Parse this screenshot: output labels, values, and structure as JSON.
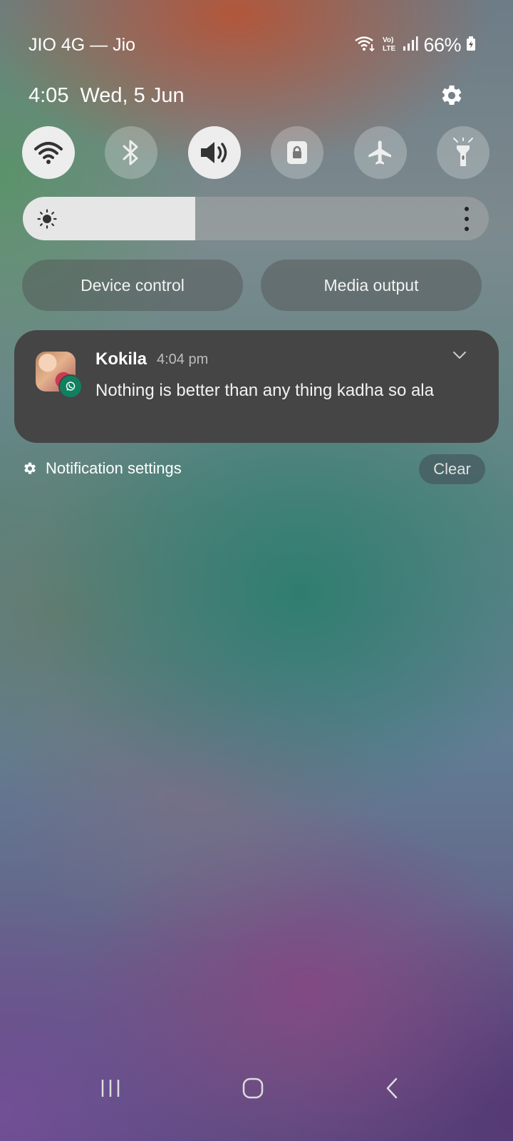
{
  "status_bar": {
    "carrier": "JIO 4G — Jio",
    "battery": "66%",
    "icons": [
      "wifi-calling-icon",
      "volte-icon",
      "signal-icon",
      "battery-charging-icon"
    ]
  },
  "header": {
    "time": "4:05",
    "date": "Wed, 5 Jun"
  },
  "quick_settings": [
    {
      "name": "wifi",
      "state": "on"
    },
    {
      "name": "bluetooth",
      "state": "off"
    },
    {
      "name": "sound",
      "state": "on"
    },
    {
      "name": "screen-lock",
      "state": "off"
    },
    {
      "name": "airplane-mode",
      "state": "off"
    },
    {
      "name": "flashlight",
      "state": "off"
    }
  ],
  "brightness": {
    "level": 0.37
  },
  "buttons": {
    "device_control": "Device control",
    "media_output": "Media output"
  },
  "notification": {
    "app": "WhatsApp",
    "sender": "Kokila",
    "time": "4:04 pm",
    "message": "Nothing is better than any thing kadha so ala"
  },
  "footer": {
    "settings_label": "Notification settings",
    "clear_label": "Clear"
  },
  "colors": {
    "toggle_on": "#ededed",
    "card_bg": "#454545",
    "whatsapp_green": "#11805f"
  }
}
